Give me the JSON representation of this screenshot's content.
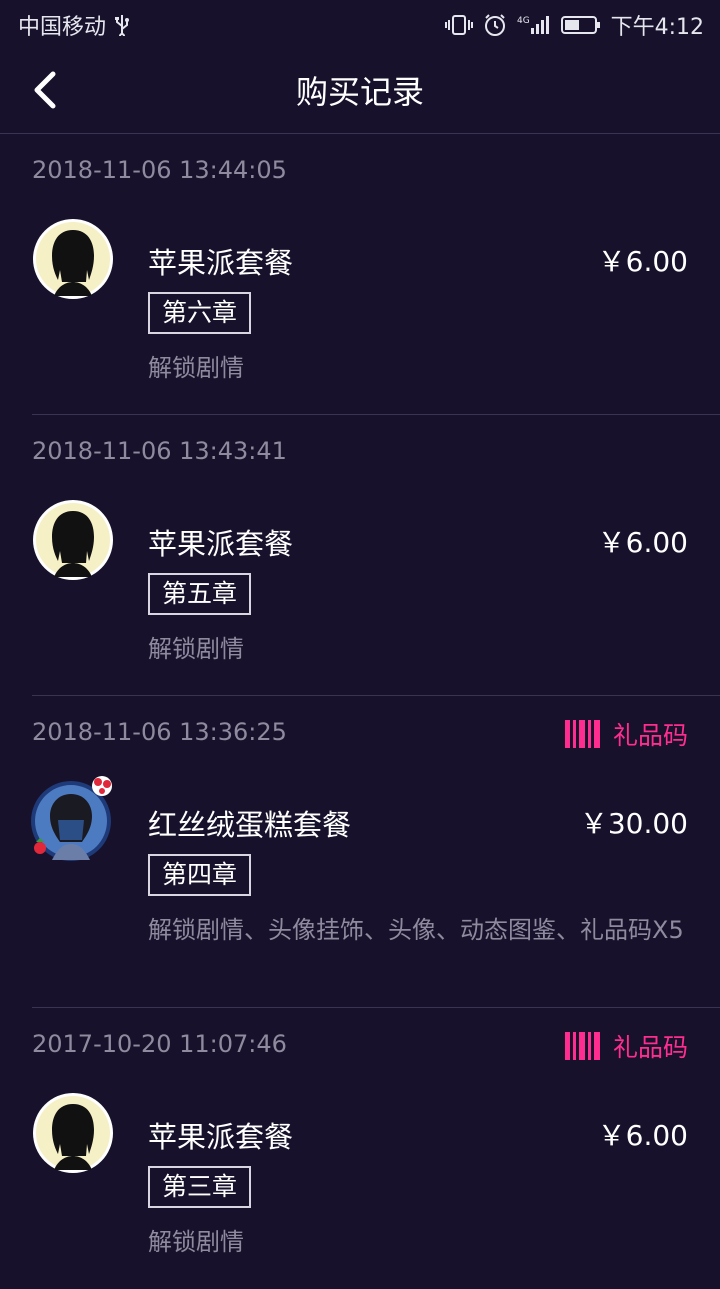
{
  "status_bar": {
    "carrier": "中国移动",
    "network": "4G",
    "time": "下午4:12"
  },
  "header": {
    "title": "购买记录"
  },
  "colors": {
    "background": "#17112b",
    "accent": "#ff2d8f",
    "muted": "#8f8a9e"
  },
  "records": [
    {
      "date": "2018-11-06 13:44:05",
      "gift_code": "",
      "package_name": "苹果派套餐",
      "price": "￥6.00",
      "chapter": "第六章",
      "description": "解锁剧情",
      "avatar": "silhouette-girl"
    },
    {
      "date": "2018-11-06 13:43:41",
      "gift_code": "",
      "package_name": "苹果派套餐",
      "price": "￥6.00",
      "chapter": "第五章",
      "description": "解锁剧情",
      "avatar": "silhouette-girl"
    },
    {
      "date": "2018-11-06 13:36:25",
      "gift_code": "礼品码",
      "package_name": "红丝绒蛋糕套餐",
      "price": "￥30.00",
      "chapter": "第四章",
      "description": "解锁剧情、头像挂饰、头像、动态图鉴、礼品码X5",
      "avatar": "girl-with-cake-ornament"
    },
    {
      "date": "2017-10-20 11:07:46",
      "gift_code": "礼品码",
      "package_name": "苹果派套餐",
      "price": "￥6.00",
      "chapter": "第三章",
      "description": "解锁剧情",
      "avatar": "silhouette-girl"
    }
  ]
}
